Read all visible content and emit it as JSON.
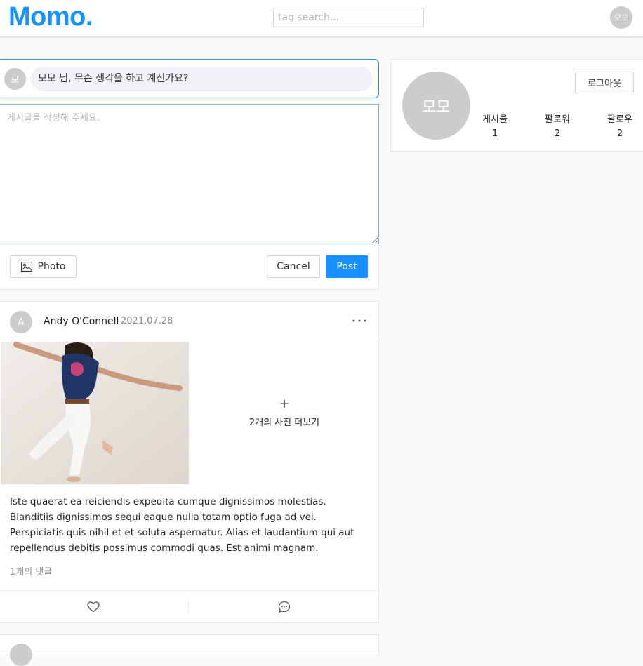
{
  "header": {
    "logo": "Momo.",
    "search_placeholder": "tag search...",
    "avatar_text": "모모"
  },
  "compose": {
    "avatar_text": "모",
    "prompt": "모모 님, 무슨 생각을 하고 계신가요?",
    "textarea_placeholder": "게시글을 작성해 주세요.",
    "photo_label": "Photo",
    "cancel_label": "Cancel",
    "post_label": "Post"
  },
  "post": {
    "avatar_text": "A",
    "author": "Andy O'Connell",
    "date": "2021.07.28",
    "more_icon": "more-dots-icon",
    "more_photos_plus": "+",
    "more_photos_label": "2개의 사진 더보기",
    "body": "Iste quaerat ea reiciendis expedita cumque dignissimos molestias. Blanditiis dignissimos sequi eaque nulla totam optio fuga ad vel. Perspiciatis quis nihil et et soluta aspernatur. Alias et laudantium qui aut repellendus debitis possimus commodi quas. Est animi magnam.",
    "comments": "1개의 댓글",
    "like_icon": "heart-icon",
    "comment_icon": "speech-bubble-icon"
  },
  "profile": {
    "avatar_text": "모모",
    "logout_label": "로그아웃",
    "stats": [
      {
        "label": "게시물",
        "value": "1"
      },
      {
        "label": "팔로워",
        "value": "2"
      },
      {
        "label": "팔로우",
        "value": "2"
      }
    ]
  },
  "colors": {
    "brand": "#1890ff",
    "avatar_bg": "#cccccc"
  }
}
